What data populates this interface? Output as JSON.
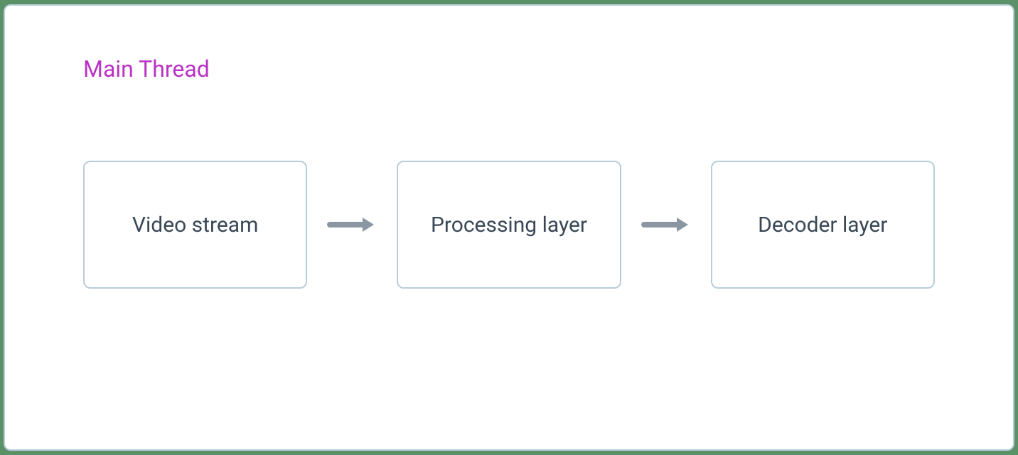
{
  "diagram": {
    "title": "Main Thread",
    "nodes": [
      {
        "label": "Video stream"
      },
      {
        "label": "Processing layer"
      },
      {
        "label": "Decoder layer"
      }
    ]
  },
  "colors": {
    "title": "#b933c4",
    "border": "#b8cdd9",
    "text": "#3a4856",
    "arrow": "#8a97a3",
    "background": "#ffffff",
    "outer": "#5a9166"
  }
}
